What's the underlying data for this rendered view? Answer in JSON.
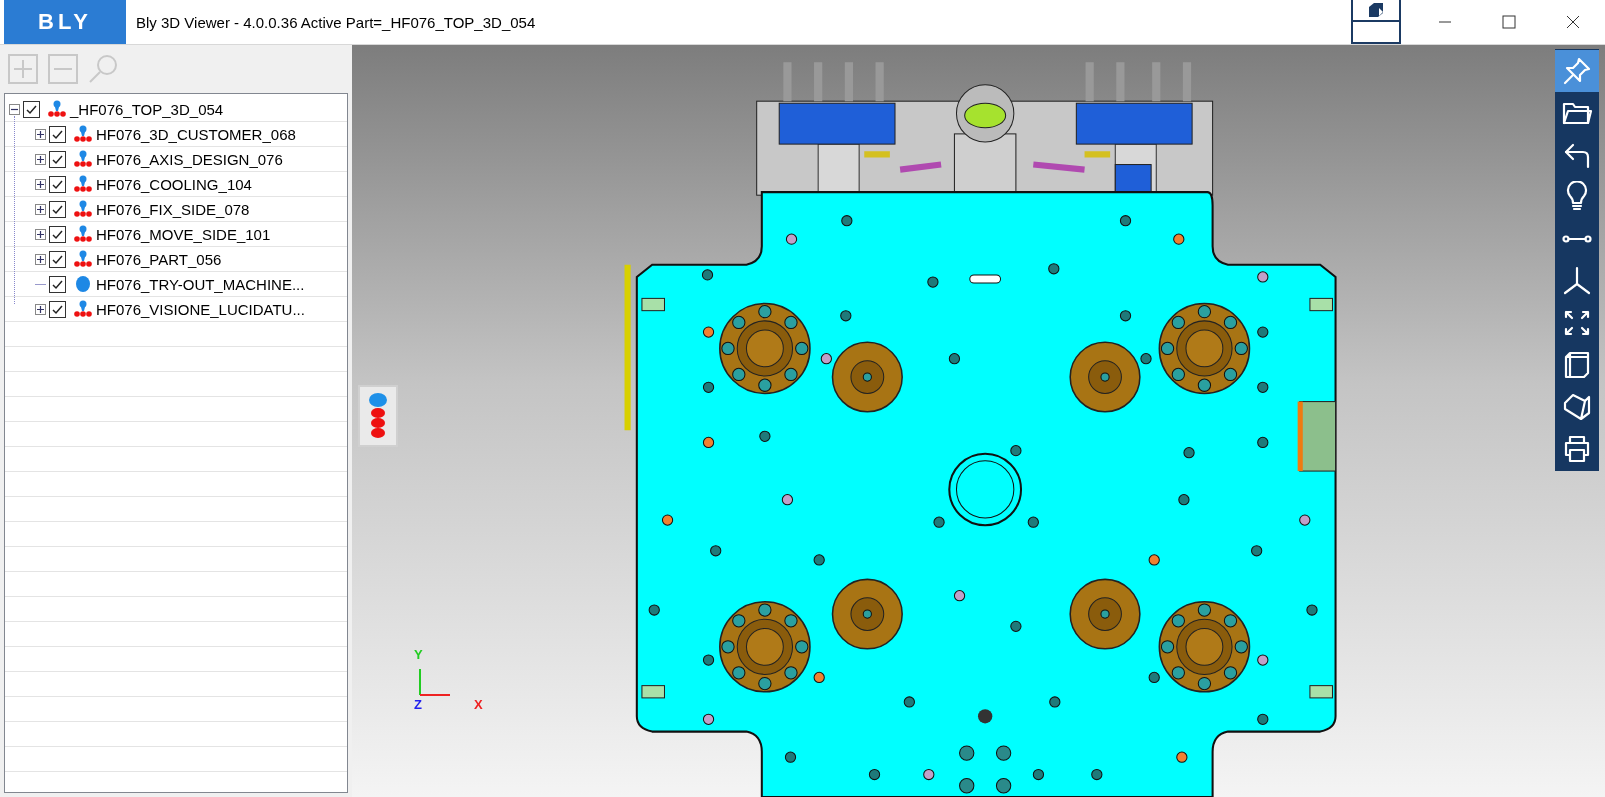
{
  "window": {
    "logo": "BLY",
    "title": "Bly 3D Viewer - 4.0.0.36 Active Part=_HF076_TOP_3D_054"
  },
  "tree_toolbar": [
    {
      "kind": "expand",
      "disabled": true
    },
    {
      "kind": "collapse",
      "disabled": true
    },
    {
      "kind": "search",
      "disabled": true
    }
  ],
  "tree": [
    {
      "name": "_HF076_TOP_3D_054",
      "kind": "assembly",
      "checked": true,
      "expanded": true,
      "children": [
        {
          "name": "HF076_3D_CUSTOMER_068",
          "kind": "assembly",
          "checked": true,
          "expanded": false
        },
        {
          "name": "HF076_AXIS_DESIGN_076",
          "kind": "assembly",
          "checked": true,
          "expanded": false
        },
        {
          "name": "HF076_COOLING_104",
          "kind": "assembly",
          "checked": true,
          "expanded": false
        },
        {
          "name": "HF076_FIX_SIDE_078",
          "kind": "assembly",
          "checked": true,
          "expanded": false
        },
        {
          "name": "HF076_MOVE_SIDE_101",
          "kind": "assembly",
          "checked": true,
          "expanded": false
        },
        {
          "name": "HF076_PART_056",
          "kind": "assembly",
          "checked": true,
          "expanded": false
        },
        {
          "name": "HF076_TRY-OUT_MACHINE...",
          "kind": "part",
          "checked": true
        },
        {
          "name": "HF076_VISIONE_LUCIDATU...",
          "kind": "assembly",
          "checked": true,
          "expanded": false
        }
      ]
    }
  ],
  "axes": [
    {
      "label": "Y",
      "color": "#22cc22"
    },
    {
      "label": "Z",
      "color": "#2222ee"
    },
    {
      "label": "X",
      "color": "#ee2222"
    }
  ],
  "tools": [
    {
      "kind": "pin",
      "selected": true
    },
    {
      "kind": "open",
      "selected": false
    },
    {
      "kind": "undo",
      "selected": false
    },
    {
      "kind": "bulb",
      "selected": false
    },
    {
      "kind": "measure",
      "selected": false
    },
    {
      "kind": "axes",
      "selected": false
    },
    {
      "kind": "fit",
      "selected": false
    },
    {
      "kind": "box",
      "selected": false
    },
    {
      "kind": "section",
      "selected": false
    },
    {
      "kind": "print",
      "selected": false
    }
  ]
}
